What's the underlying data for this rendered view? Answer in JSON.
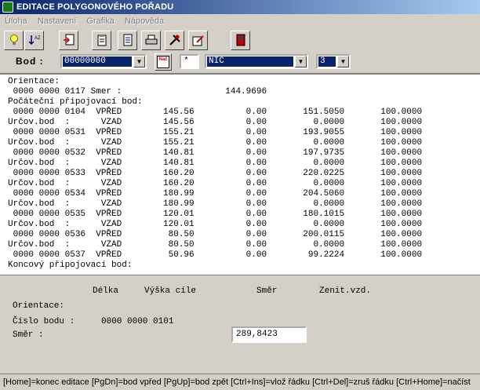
{
  "window": {
    "title": "EDITACE POLYGONOVÉHO POŘADU"
  },
  "menu": [
    "Úloha",
    "Nastavení",
    "Grafika",
    "Nápověda"
  ],
  "toolbar": {
    "buttons": [
      "lightbulb-icon",
      "sort-icon",
      "doc-arrow-icon",
      "clipboard-icon",
      "page-icon",
      "printer-icon",
      "tools-icon",
      "edit-icon",
      "exit-door-icon"
    ]
  },
  "filter": {
    "bod_label": "Bod :",
    "bod_value": "00000000",
    "nac_label": "Nač",
    "star_value": "*",
    "code_value": "NIC",
    "num_value": "3"
  },
  "listing": {
    "rows": [
      "Orientace:",
      " 0000 0000 0117 Smer :                    144.9696",
      "Počáteční připojovací bod:",
      " 0000 0000 0104  VPŘED        145.56          0.00       151.5050       100.0000",
      "Určov.bod  :      VZAD        145.56          0.00         0.0000       100.0000",
      " 0000 0000 0531  VPŘED        155.21          0.00       193.9055       100.0000",
      "Určov.bod  :      VZAD        155.21          0.00         0.0000       100.0000",
      " 0000 0000 0532  VPŘED        140.81          0.00       197.9735       100.0000",
      "Určov.bod  :      VZAD        140.81          0.00         0.0000       100.0000",
      " 0000 0000 0533  VPŘED        160.20          0.00       220.0225       100.0000",
      "Určov.bod  :      VZAD        160.20          0.00         0.0000       100.0000",
      " 0000 0000 0534  VPŘED        180.99          0.00       204.5060       100.0000",
      "Určov.bod  :      VZAD        180.99          0.00         0.0000       100.0000",
      " 0000 0000 0535  VPŘED        120.01          0.00       180.1015       100.0000",
      "Určov.bod  :      VZAD        120.01          0.00         0.0000       100.0000",
      " 0000 0000 0536  VPŘED         80.50          0.00       200.0115       100.0000",
      "Určov.bod  :      VZAD         80.50          0.00         0.0000       100.0000",
      " 0000 0000 0537  VPŘED         50.96          0.00        99.2224       100.0000",
      "Koncový připojovací bod:"
    ]
  },
  "entry": {
    "col_delka": "Délka",
    "col_vyska": "Výška cíle",
    "col_smer": "Směr",
    "col_zenit": "Zenit.vzd.",
    "orientace_label": "Orientace:",
    "cislo_label": "Číslo bodu :",
    "cislo_value": "0000 0000 0101",
    "smer_label": "Směr  :",
    "smer_value": "289,8423"
  },
  "status": {
    "text": "[Home]=konec editace [PgDn]=bod vpřed [PgUp]=bod zpět [Ctrl+Ins]=vlož řádku [Ctrl+Del]=zruš řádku [Ctrl+Home]=načíst"
  }
}
